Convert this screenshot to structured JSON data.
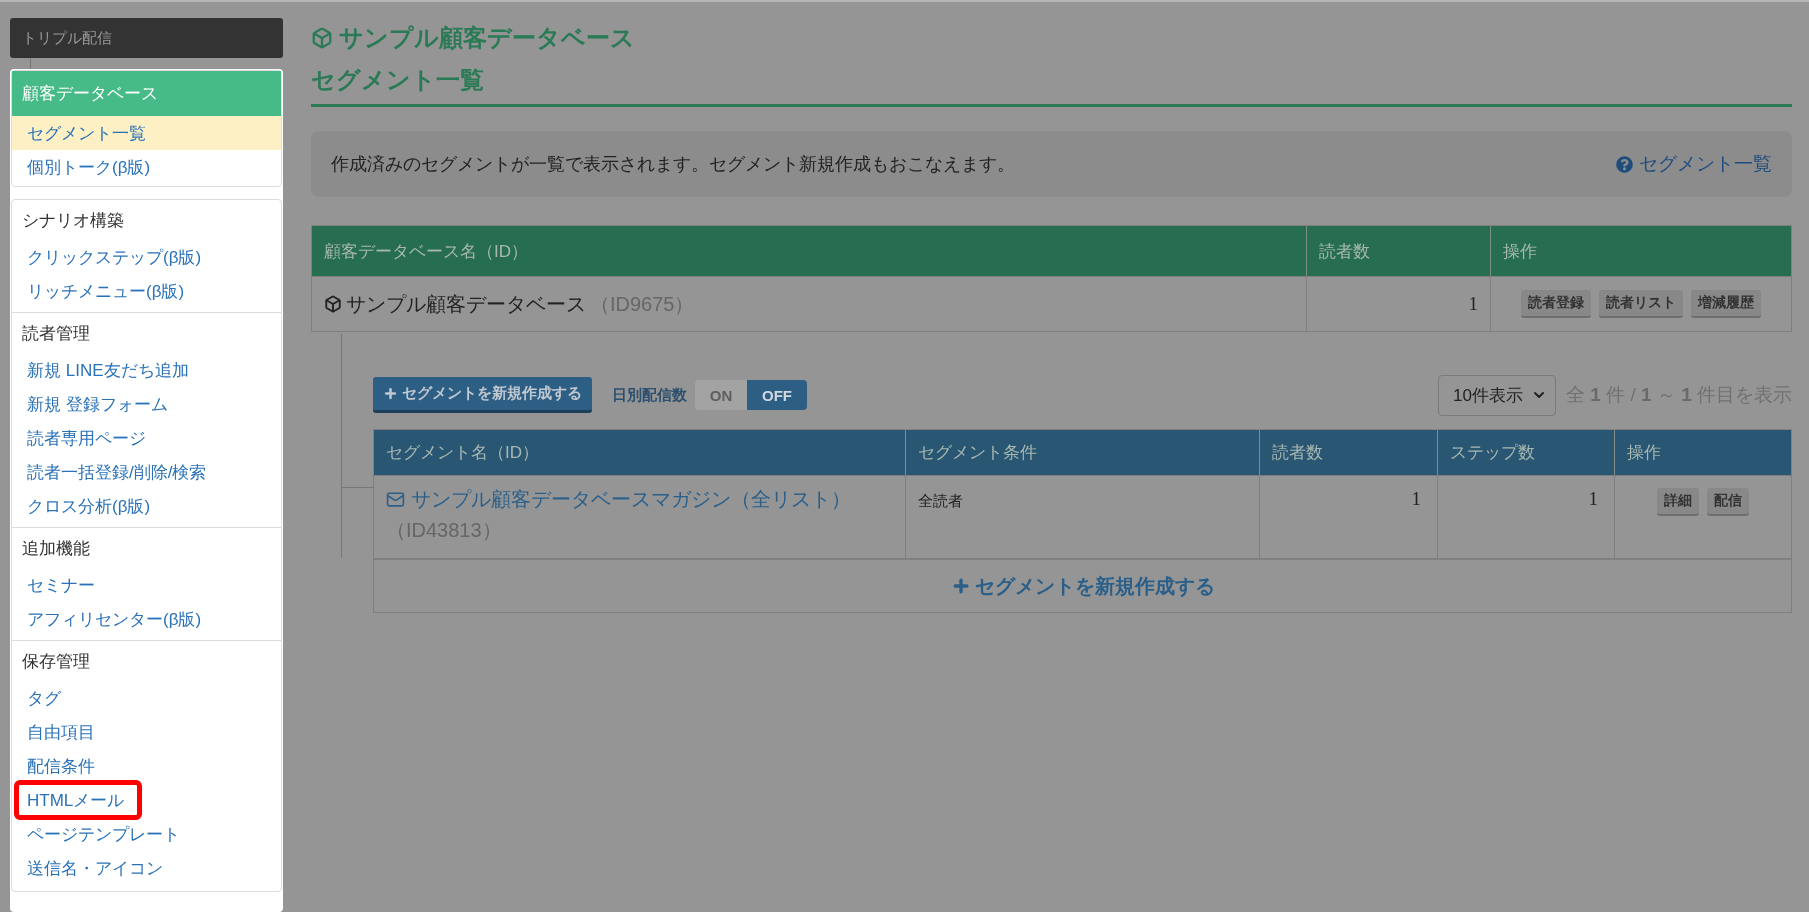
{
  "app_title": "トリプル配信",
  "sidebar": {
    "groups": [
      {
        "title": "顧客データベース",
        "kind": "banner",
        "items": [
          {
            "label": "セグメント一覧",
            "selected": true,
            "highlighted": false
          },
          {
            "label": "個別トーク(β版)",
            "selected": false,
            "highlighted": false
          }
        ]
      },
      {
        "title": "シナリオ構築",
        "kind": "plain",
        "items": [
          {
            "label": "クリックステップ(β版)",
            "selected": false,
            "highlighted": false
          },
          {
            "label": "リッチメニュー(β版)",
            "selected": false,
            "highlighted": false
          }
        ]
      },
      {
        "title": "読者管理",
        "kind": "plain",
        "items": [
          {
            "label": "新規 LINE友だち追加",
            "selected": false,
            "highlighted": false
          },
          {
            "label": "新規 登録フォーム",
            "selected": false,
            "highlighted": false
          },
          {
            "label": "読者専用ページ",
            "selected": false,
            "highlighted": false
          },
          {
            "label": "読者一括登録/削除/検索",
            "selected": false,
            "highlighted": false
          },
          {
            "label": "クロス分析(β版)",
            "selected": false,
            "highlighted": false
          }
        ]
      },
      {
        "title": "追加機能",
        "kind": "plain",
        "items": [
          {
            "label": "セミナー",
            "selected": false,
            "highlighted": false
          },
          {
            "label": "アフィリセンター(β版)",
            "selected": false,
            "highlighted": false
          }
        ]
      },
      {
        "title": "保存管理",
        "kind": "plain",
        "items": [
          {
            "label": "タグ",
            "selected": false,
            "highlighted": false
          },
          {
            "label": "自由項目",
            "selected": false,
            "highlighted": false
          },
          {
            "label": "配信条件",
            "selected": false,
            "highlighted": false
          },
          {
            "label": "HTMLメール",
            "selected": false,
            "highlighted": true
          },
          {
            "label": "ページテンプレート",
            "selected": false,
            "highlighted": false
          },
          {
            "label": "送信名・アイコン",
            "selected": false,
            "highlighted": false
          }
        ]
      }
    ]
  },
  "page": {
    "title": "サンプル顧客データベース",
    "subtitle": "セグメント一覧",
    "info_text": "作成済みのセグメントが一覧で表示されます。セグメント新規作成もおこなえます。",
    "help_link": "セグメント一覧"
  },
  "database_table": {
    "columns": [
      "顧客データベース名（ID）",
      "読者数",
      "操作"
    ],
    "rows": [
      {
        "name": "サンプル顧客データベース",
        "id": "（ID9675）",
        "readers": "1",
        "actions": [
          "読者登録",
          "読者リスト",
          "増減履歴"
        ]
      }
    ]
  },
  "segment_toolbar": {
    "new_button": "セグメントを新規作成する",
    "daily_label": "日別配信数",
    "toggle": [
      {
        "label": "ON",
        "selected": false
      },
      {
        "label": "OFF",
        "selected": true
      }
    ],
    "page_size": "10件表示",
    "summary": "全 **1** 件 / **1** ～ **1** 件目を表示"
  },
  "segment_table": {
    "columns": [
      "セグメント名（ID）",
      "セグメント条件",
      "読者数",
      "ステップ数",
      "操作"
    ],
    "rows": [
      {
        "name": "サンプル顧客データベースマガジン（全リスト）",
        "id": "（ID43813）",
        "condition": "全読者",
        "readers": "1",
        "steps": "1",
        "actions": [
          "詳細",
          "配信"
        ]
      }
    ],
    "footer_button": "セグメントを新規作成する"
  }
}
